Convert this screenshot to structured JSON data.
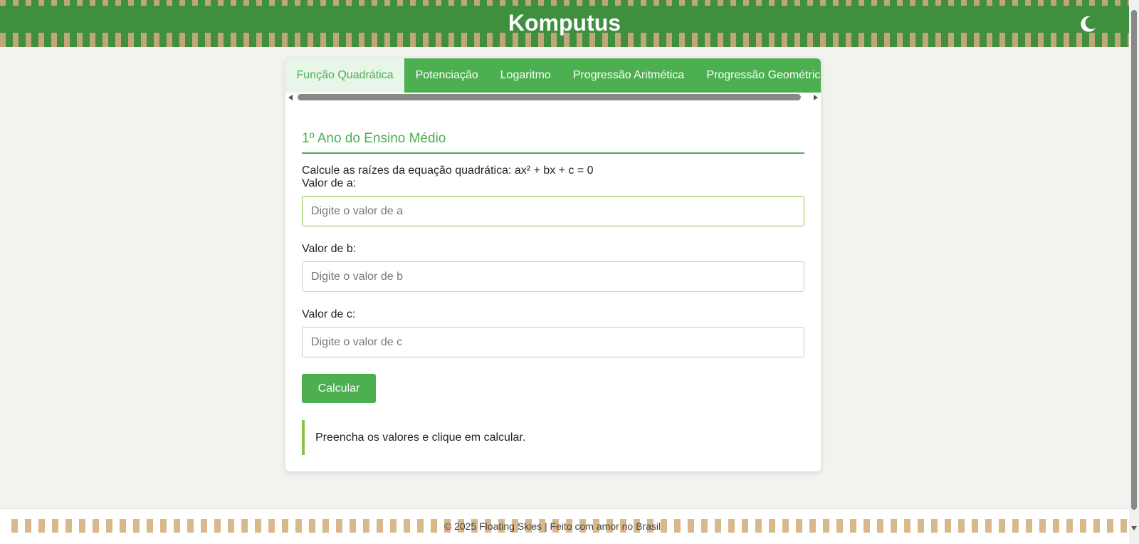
{
  "header": {
    "title": "Komputus",
    "theme_icon": "moon-icon"
  },
  "tabs": [
    {
      "label": "Função Quadrática",
      "active": true
    },
    {
      "label": "Potenciação",
      "active": false
    },
    {
      "label": "Logaritmo",
      "active": false
    },
    {
      "label": "Progressão Aritmética",
      "active": false
    },
    {
      "label": "Progressão Geométrica",
      "active": false
    }
  ],
  "panel": {
    "section_title": "1º Ano do Ensino Médio",
    "description": "Calcule as raízes da equação quadrática: ax² + bx + c = 0",
    "fields": [
      {
        "label": "Valor de a:",
        "placeholder": "Digite o valor de a",
        "value": ""
      },
      {
        "label": "Valor de b:",
        "placeholder": "Digite o valor de b",
        "value": ""
      },
      {
        "label": "Valor de c:",
        "placeholder": "Digite o valor de c",
        "value": ""
      }
    ],
    "button_label": "Calcular",
    "result_text": "Preencha os valores e clique em calcular."
  },
  "footer": {
    "text": "© 2025 Floating Skies | Feito com amor no Brasil"
  },
  "colors": {
    "primary_green": "#4caf50",
    "header_green": "#3f8f3f",
    "accent_lime": "#8bc34a",
    "stripe_tan": "#bfa77a"
  }
}
